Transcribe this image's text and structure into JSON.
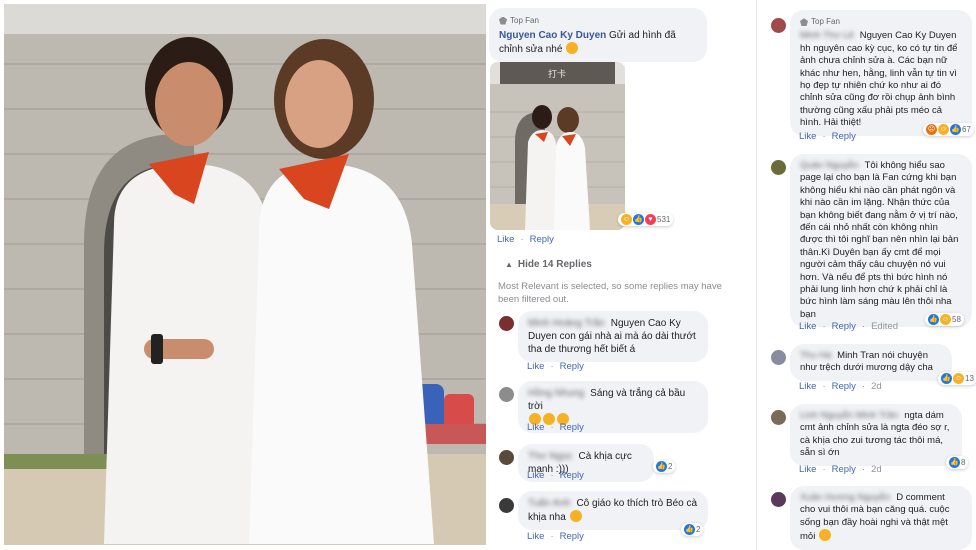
{
  "main_comment": {
    "badge": "Top Fan",
    "author": "Nguyen Cao Ky Duyen",
    "text": "Gửi ad hình đã chỉnh sửa nhé",
    "reaction_count": "531",
    "like_label": "Like",
    "reply_label": "Reply"
  },
  "replies_toggle": {
    "label": "Hide 14 Replies",
    "filter_note": "Most Relevant is selected, so some replies may have been filtered out."
  },
  "thumbnail_sign": "打卡",
  "replies": [
    {
      "author_blurred": "Minh Hoàng Trần",
      "text": "Nguyen Cao Ky Duyen con gái nhà ai mà áo dài thướt tha de thương hết biết á",
      "like": "Like",
      "reply": "Reply"
    },
    {
      "author_blurred": "Hồng Nhung",
      "text": "Sáng và trắng cả bầu trời",
      "like": "Like",
      "reply": "Reply"
    },
    {
      "author_blurred": "Thư Ngọc",
      "text": "Cà khịa cực mạnh :)))",
      "count": "2",
      "like": "Like",
      "reply": "Reply"
    },
    {
      "author_blurred": "Tuấn Anh",
      "text": "Cô giáo ko thích trò Béo cà khịa nha",
      "count": "2",
      "like": "Like",
      "reply": "Reply"
    }
  ],
  "right_comments": [
    {
      "badge": "Top Fan",
      "author_blurred": "Minh Thư Lê",
      "text": "Nguyen Cao Ky Duyen hh nguyên cao kỳ cục, ko có tự tin để ảnh chưa chỉnh sửa à. Các bạn nữ khác như hen, hằng, linh vẫn tự tin vì họ đẹp tự nhiên chứ ko như ai đó chỉnh sửa cũng đơ rồi chụp ảnh bình thường cũng xấu phải pts méo cả hình. Hải thiệt!",
      "count": "67",
      "like": "Like",
      "reply": "Reply"
    },
    {
      "author_blurred": "Quân Nguyễn",
      "text": "Tôi không hiểu sao page lại cho bạn là Fan cứng khi bạn không hiểu khi nào cần phát ngôn và khi nào cần im lặng. Nhận thức của bạn không biết đang nằm ở vị trí nào, đến cái nhỏ nhất còn không nhìn được thì tôi nghĩ bạn nên nhìn lại bản thân.Kì Duyên bạn ấy cmt để mọi người cảm thấy câu chuyện nó vui hơn. Và nếu để pts thì bức hình nó phải lung linh hơn chứ k phải chỉ là bức hình làm sáng màu lên thôi nha bạn",
      "count": "58",
      "like": "Like",
      "reply": "Reply",
      "edited": "Edited"
    },
    {
      "author_blurred": "Thu Hà",
      "text": "Minh Tran nói chuyện như trệch dưới mương dậy cha",
      "count": "13",
      "like": "Like",
      "reply": "Reply",
      "time": "2d"
    },
    {
      "author_blurred": "Linh Nguyễn Minh Trần",
      "text": "ngta dám cmt ảnh chỉnh sửa là ngta đéo sợ r, cà khịa cho zui tương tác thôi má, sẵn sì ớn",
      "count": "8",
      "like": "Like",
      "reply": "Reply",
      "time": "2d"
    },
    {
      "author_blurred": "Xuân Hương Nguyễn",
      "text": "D comment cho vui thôi mà bạn căng quá. cuộc sống bạn đầy hoài nghi và thật mệt mỏi",
      "like": "Like",
      "reply": "Reply"
    }
  ],
  "colors": {
    "link_blue": "#385898",
    "bubble_bg": "#f0f2f5",
    "meta_gray": "#65676b",
    "like_blue": "#1877f2",
    "love_red": "#f33e58",
    "haha_yellow": "#f7b125"
  }
}
